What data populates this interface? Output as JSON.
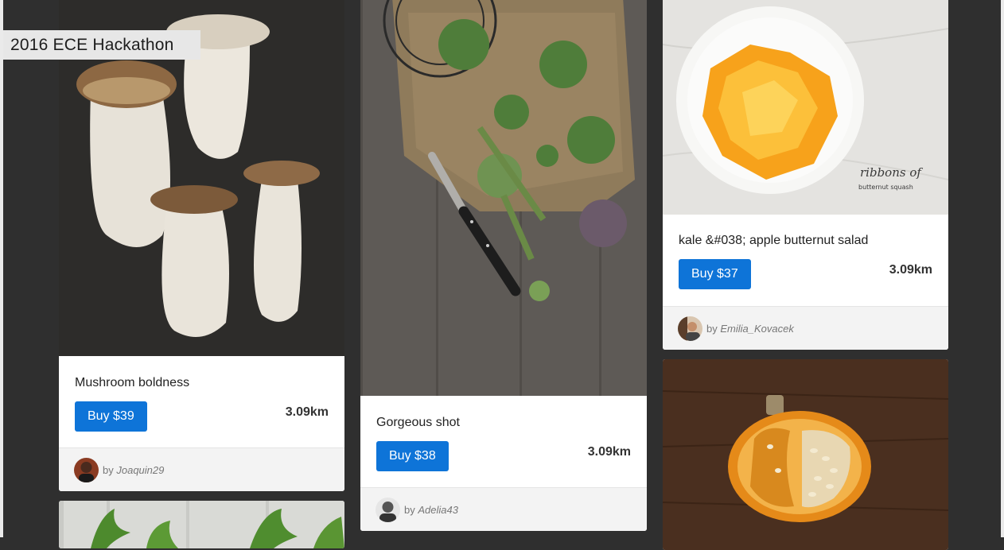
{
  "app": {
    "title": "2016 ECE Hackathon"
  },
  "cards": [
    {
      "title": "Mushroom boldness",
      "buy_label": "Buy $39",
      "distance": "3.09km",
      "by_prefix": "by",
      "author": "Joaquin29"
    },
    {
      "title": "Gorgeous shot",
      "buy_label": "Buy $38",
      "distance": "3.09km",
      "by_prefix": "by",
      "author": "Adelia43"
    },
    {
      "title": "kale &#038; apple butternut salad",
      "buy_label": "Buy $37",
      "distance": "3.09km",
      "by_prefix": "by",
      "author": "Emilia_Kovacek",
      "photo_caption_1": "ribbons of",
      "photo_caption_2": "butternut squash"
    }
  ],
  "colors": {
    "background": "#2f2f2f",
    "button": "#0e74d8",
    "footer": "#f3f3f3"
  }
}
